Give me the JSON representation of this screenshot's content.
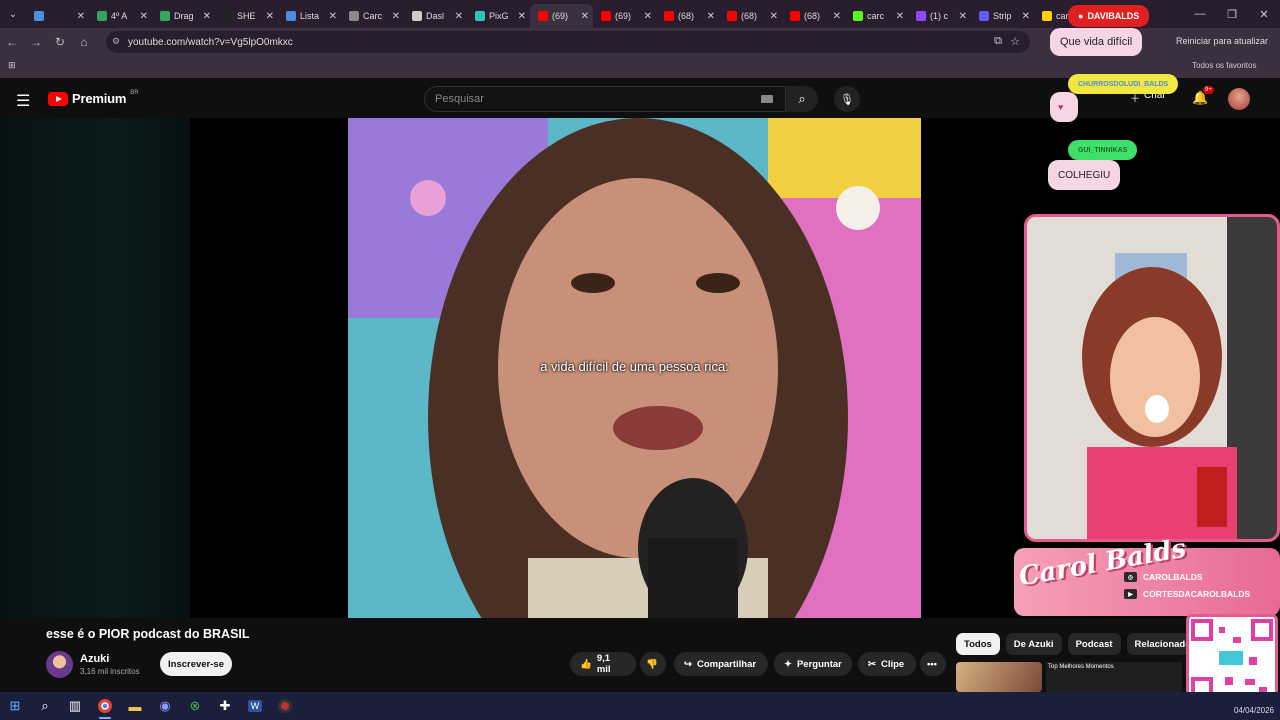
{
  "browser": {
    "tabs": [
      {
        "title": "",
        "color": "#4a8fe0"
      },
      {
        "title": "4º A",
        "color": "#34a853"
      },
      {
        "title": "Drag",
        "color": "#34a853"
      },
      {
        "title": "SHE",
        "color": "#222222"
      },
      {
        "title": "Lista",
        "color": "#4a8fe0"
      },
      {
        "title": "Carc",
        "color": "#888888"
      },
      {
        "title": "Dasl",
        "color": "#cccccc"
      },
      {
        "title": "PixG",
        "color": "#2ec4b6"
      },
      {
        "title": "(69)",
        "color": "#ff0000",
        "active": true
      },
      {
        "title": "(69)",
        "color": "#ff0000"
      },
      {
        "title": "(68)",
        "color": "#ff0000"
      },
      {
        "title": "(68)",
        "color": "#ff0000"
      },
      {
        "title": "(68)",
        "color": "#ff0000"
      },
      {
        "title": "carc",
        "color": "#53fc18"
      },
      {
        "title": "(1) c",
        "color": "#9146ff"
      },
      {
        "title": "Strip",
        "color": "#635bff"
      },
      {
        "title": "carc",
        "color": "#ffd400"
      }
    ],
    "url": "youtube.com/watch?v=Vg5lpO0mkxc",
    "reload_label": "Reiniciar para atualizar",
    "bookmarks_label": "Todos os favoritos"
  },
  "youtube": {
    "logo_text": "Premium",
    "logo_region": "BR",
    "search_placeholder": "Pesquisar",
    "create_label": "Criar",
    "notif_count": "9+",
    "video_subtitle": "a vida difícil de uma pessoa rica:",
    "video_title": "esse é o PIOR podcast do BRASIL",
    "channel_name": "Azuki",
    "channel_subs": "3,16 mil inscritos",
    "subscribe_label": "Inscrever-se",
    "likes": "9,1 mil",
    "share_label": "Compartilhar",
    "ask_label": "Perguntar",
    "clip_label": "Clipe",
    "chips": [
      "Todos",
      "De Azuki",
      "Podcast",
      "Relacionados"
    ],
    "rec_text": "Top Melhores Momentos"
  },
  "overlay": {
    "username_badge": "DAVIBALDS",
    "chat_message": "Que vida difícil",
    "user2": "CHURROSDOLUDI_BALDS",
    "user3": "GUI_TINNIKAS",
    "chat_message2": "COLHEGIU",
    "brand_name": "Carol Balds",
    "social1": "CAROLBALDS",
    "social2": "CORTESDACAROLBALDS",
    "accent": "#e55a90"
  },
  "taskbar": {
    "icons": [
      "start-icon",
      "search-icon",
      "taskview-icon",
      "chrome-icon",
      "explorer-icon",
      "discord-icon",
      "xbox-icon",
      "defender-icon",
      "word-icon",
      "obs-icon"
    ],
    "date": "04/04/2026"
  }
}
